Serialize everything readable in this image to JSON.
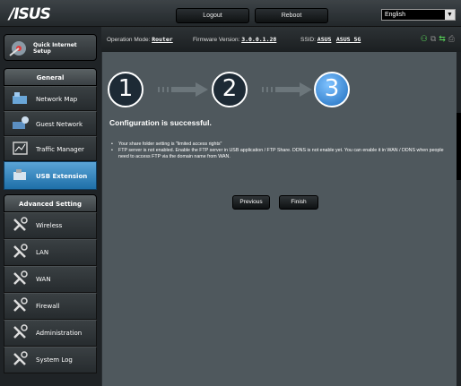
{
  "brand": "/ISUS",
  "topbar": {
    "logout_label": "Logout",
    "reboot_label": "Reboot",
    "language": "English"
  },
  "sidebar": {
    "quick_setup_label": "Quick Internet Setup",
    "general_header": "General",
    "general_items": [
      {
        "label": "Network Map",
        "icon": "network-map-icon"
      },
      {
        "label": "Guest Network",
        "icon": "guest-network-icon"
      },
      {
        "label": "Traffic Manager",
        "icon": "traffic-manager-icon"
      },
      {
        "label": "USB Extension",
        "icon": "usb-extension-icon",
        "active": true
      }
    ],
    "advanced_header": "Advanced Setting",
    "advanced_items": [
      {
        "label": "Wireless",
        "icon": "wrench-icon"
      },
      {
        "label": "LAN",
        "icon": "wrench-icon"
      },
      {
        "label": "WAN",
        "icon": "wrench-icon"
      },
      {
        "label": "Firewall",
        "icon": "wrench-icon"
      },
      {
        "label": "Administration",
        "icon": "wrench-icon"
      },
      {
        "label": "System Log",
        "icon": "wrench-icon"
      }
    ]
  },
  "status": {
    "op_mode_label": "Operation Mode:",
    "op_mode_value": "Router",
    "fw_label": "Firmware Version:",
    "fw_value": "3.0.0.1.28",
    "ssid_label": "SSID:",
    "ssid_1": "ASUS",
    "ssid_2": "ASUS_5G"
  },
  "wizard": {
    "steps": [
      "1",
      "2",
      "3"
    ],
    "current_step": 3,
    "title": "Configuration is successful.",
    "messages": [
      "Your share folder setting is \"limited access rights\"",
      "FTP server is not enabled. Enable the FTP server in USB application / FTP Share. DDNS is not enable yet. You can enable it in WAN / DDNS when people need to access FTP via the domain name from WAN."
    ],
    "previous_label": "Previous",
    "finish_label": "Finish"
  },
  "colors": {
    "accent": "#2f7fc0",
    "panel": "#4f585d",
    "background": "#1f2326"
  }
}
